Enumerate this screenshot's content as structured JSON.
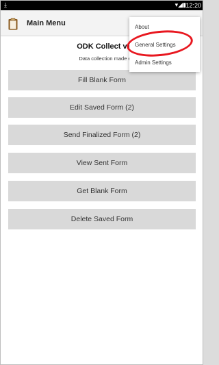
{
  "status_bar": {
    "download_icon": "download-arrow-icon",
    "signal_icons": "▾◢▮",
    "clock": "12:20"
  },
  "action_bar": {
    "icon": "clipboard-icon",
    "title": "Main Menu"
  },
  "header": {
    "app_name": "ODK Collect v1.",
    "tagline": "Data collection made e"
  },
  "menu_buttons": [
    {
      "label": "Fill Blank Form"
    },
    {
      "label": "Edit Saved Form (2)"
    },
    {
      "label": "Send Finalized Form (2)"
    },
    {
      "label": "View Sent Form"
    },
    {
      "label": "Get Blank Form"
    },
    {
      "label": "Delete Saved Form"
    }
  ],
  "overflow_menu": {
    "items": [
      {
        "label": "About"
      },
      {
        "label": "General Settings"
      },
      {
        "label": "Admin Settings"
      }
    ]
  },
  "colors": {
    "accent": "#e8171f",
    "button_bg": "#d9d9d9",
    "action_bar_bg": "#f3f3f3",
    "clipboard_brown": "#8a5a1f"
  }
}
